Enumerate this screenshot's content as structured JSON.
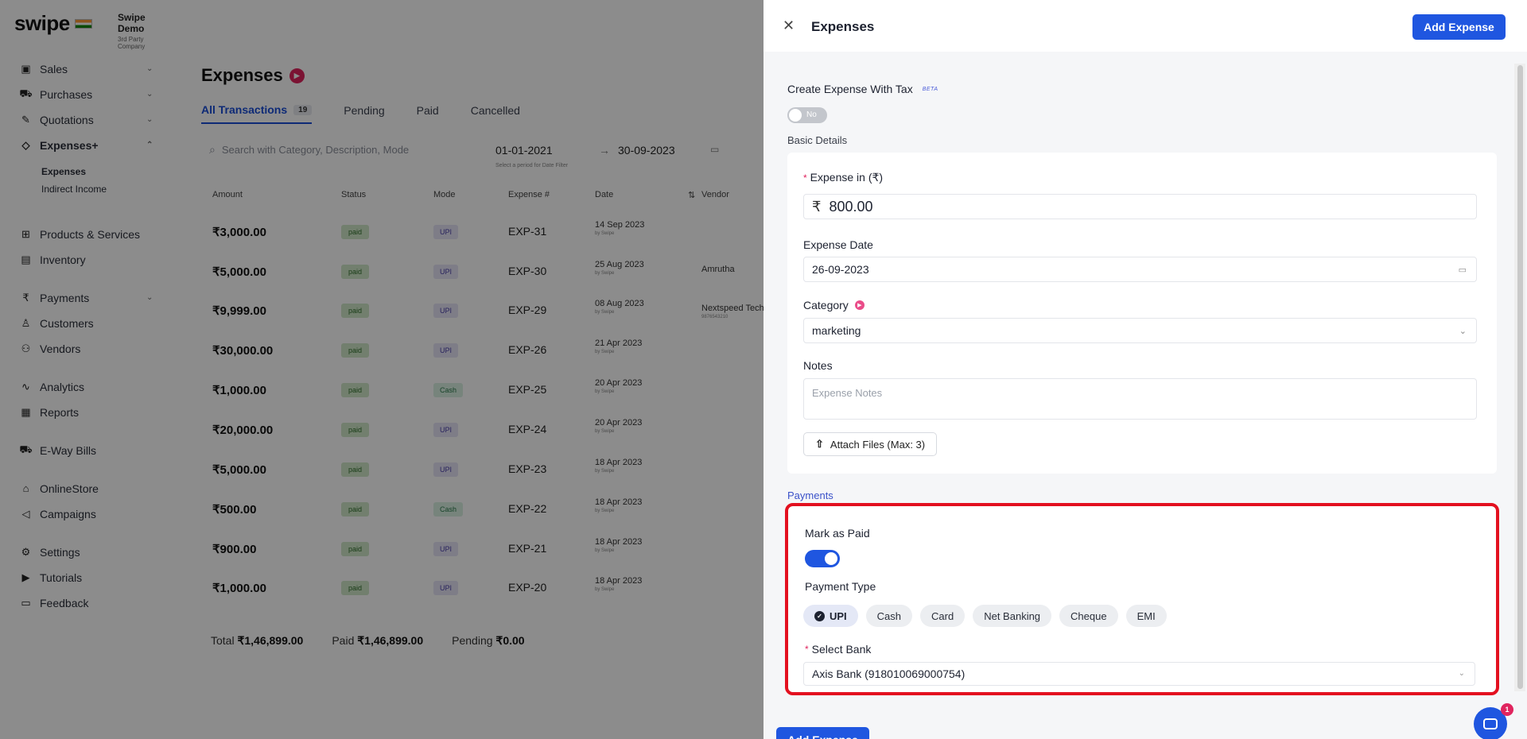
{
  "sidebar": {
    "brand": "swipe",
    "company_name": "Swipe Demo",
    "company_sub": "3rd Party Company",
    "nav": [
      {
        "label": "Sales",
        "icon": "sales-icon",
        "top": 0
      },
      {
        "label": "Purchases",
        "icon": "cart-icon"
      },
      {
        "label": "Quotations",
        "icon": "pen-icon"
      },
      {
        "label": "Expenses+",
        "icon": "tag-icon"
      },
      {
        "label": "Products & Services",
        "icon": "box-icon"
      },
      {
        "label": "Inventory",
        "icon": "warehouse-icon"
      },
      {
        "label": "Payments",
        "icon": "rupee-icon"
      },
      {
        "label": "Customers",
        "icon": "user-icon"
      },
      {
        "label": "Vendors",
        "icon": "users-icon"
      },
      {
        "label": "Analytics",
        "icon": "chart-icon"
      },
      {
        "label": "Reports",
        "icon": "report-icon"
      },
      {
        "label": "E-Way Bills",
        "icon": "truck-icon"
      },
      {
        "label": "OnlineStore",
        "icon": "store-icon"
      },
      {
        "label": "Campaigns",
        "icon": "megaphone-icon"
      },
      {
        "label": "Settings",
        "icon": "gear-icon"
      },
      {
        "label": "Tutorials",
        "icon": "video-icon"
      },
      {
        "label": "Feedback",
        "icon": "message-icon"
      }
    ],
    "sub": {
      "expenses": "Expenses",
      "indirect_income": "Indirect Income"
    }
  },
  "main": {
    "title": "Expenses",
    "tabs": {
      "all": "All Transactions",
      "all_count": "19",
      "pending": "Pending",
      "paid": "Paid",
      "cancelled": "Cancelled"
    },
    "search_placeholder": "Search with Category, Description, Mode",
    "date_from": "01-01-2021",
    "date_to": "30-09-2023",
    "date_hint": "Select a period for Date Filter",
    "columns": {
      "amount": "Amount",
      "status": "Status",
      "mode": "Mode",
      "expense_no": "Expense #",
      "date": "Date",
      "vendor": "Vendor"
    },
    "rows": [
      {
        "amount": "₹3,000.00",
        "status": "paid",
        "mode": "UPI",
        "no": "EXP-31",
        "date": "14 Sep 2023",
        "by": "by Swipe",
        "vendor": "",
        "vendor_sub": ""
      },
      {
        "amount": "₹5,000.00",
        "status": "paid",
        "mode": "UPI",
        "no": "EXP-30",
        "date": "25 Aug 2023",
        "by": "by Swipe",
        "vendor": "Amrutha",
        "vendor_sub": ""
      },
      {
        "amount": "₹9,999.00",
        "status": "paid",
        "mode": "UPI",
        "no": "EXP-29",
        "date": "08 Aug 2023",
        "by": "by Swipe",
        "vendor": "Nextspeed Technolo",
        "vendor_sub": "9876543210"
      },
      {
        "amount": "₹30,000.00",
        "status": "paid",
        "mode": "UPI",
        "no": "EXP-26",
        "date": "21 Apr 2023",
        "by": "by Swipe",
        "vendor": "",
        "vendor_sub": ""
      },
      {
        "amount": "₹1,000.00",
        "status": "paid",
        "mode": "Cash",
        "no": "EXP-25",
        "date": "20 Apr 2023",
        "by": "by Swipe",
        "vendor": "",
        "vendor_sub": ""
      },
      {
        "amount": "₹20,000.00",
        "status": "paid",
        "mode": "UPI",
        "no": "EXP-24",
        "date": "20 Apr 2023",
        "by": "by Swipe",
        "vendor": "",
        "vendor_sub": ""
      },
      {
        "amount": "₹5,000.00",
        "status": "paid",
        "mode": "UPI",
        "no": "EXP-23",
        "date": "18 Apr 2023",
        "by": "by Swipe",
        "vendor": "",
        "vendor_sub": ""
      },
      {
        "amount": "₹500.00",
        "status": "paid",
        "mode": "Cash",
        "no": "EXP-22",
        "date": "18 Apr 2023",
        "by": "by Swipe",
        "vendor": "",
        "vendor_sub": ""
      },
      {
        "amount": "₹900.00",
        "status": "paid",
        "mode": "UPI",
        "no": "EXP-21",
        "date": "18 Apr 2023",
        "by": "by Swipe",
        "vendor": "",
        "vendor_sub": ""
      },
      {
        "amount": "₹1,000.00",
        "status": "paid",
        "mode": "UPI",
        "no": "EXP-20",
        "date": "18 Apr 2023",
        "by": "by Swipe",
        "vendor": "",
        "vendor_sub": ""
      }
    ],
    "totals": {
      "total_label": "Total",
      "total": "₹1,46,899.00",
      "paid_label": "Paid",
      "paid": "₹1,46,899.00",
      "pending_label": "Pending",
      "pending": "₹0.00"
    }
  },
  "drawer": {
    "title": "Expenses",
    "add_button": "Add Expense",
    "tax_label": "Create Expense With Tax",
    "beta": "BETA",
    "tax_toggle": "No",
    "basic_details": "Basic Details",
    "expense_label": "Expense in (₹)",
    "expense_currency": "₹",
    "expense_value": "800.00",
    "date_label": "Expense Date",
    "date_value": "26-09-2023",
    "category_label": "Category",
    "category_value": "marketing",
    "notes_label": "Notes",
    "notes_placeholder": "Expense Notes",
    "attach_label": "Attach Files (Max: 3)",
    "payments_label": "Payments",
    "mark_paid_label": "Mark as Paid",
    "payment_type_label": "Payment Type",
    "payment_types": [
      "UPI",
      "Cash",
      "Card",
      "Net Banking",
      "Cheque",
      "EMI"
    ],
    "selected_payment_type": "UPI",
    "select_bank_label": "Select Bank",
    "bank_value": "Axis Bank (918010069000754)",
    "bottom_add_button": "Add Expense",
    "chat_badge": "1"
  },
  "colors": {
    "accent": "#1f56e0",
    "highlight": "#e3101f",
    "paid_badge": "#cfe8c9",
    "brand_pink": "#e0245e"
  }
}
